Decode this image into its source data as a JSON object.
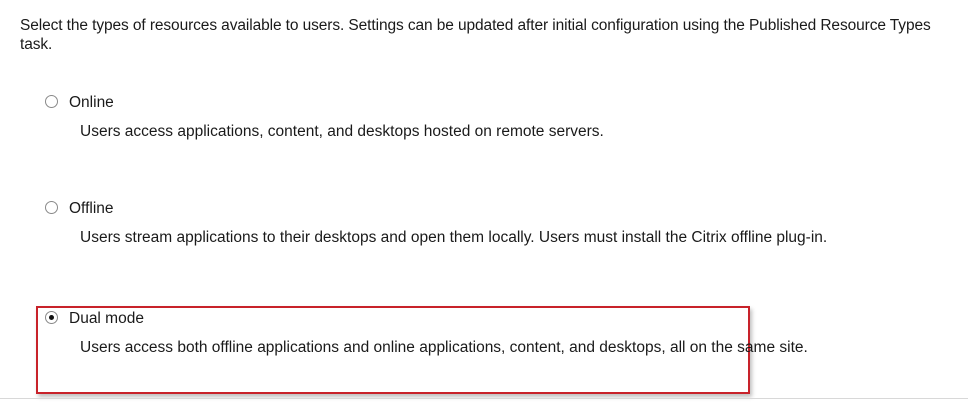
{
  "intro_text": "Select the types of resources available to users. Settings can be updated after initial configuration using the Published Resource Types task.",
  "options": [
    {
      "label": "Online",
      "description": "Users access applications, content, and desktops hosted on remote servers.",
      "selected": false
    },
    {
      "label": "Offline",
      "description": "Users stream applications to their desktops and open them locally. Users must install the Citrix offline plug-in.",
      "selected": false
    },
    {
      "label": "Dual mode",
      "description": "Users access both offline applications and online applications, content, and desktops, all on the same site.",
      "selected": true
    }
  ],
  "colors": {
    "highlight_border": "#c8222a",
    "background": "#ffffff",
    "text": "#1a1a1a"
  }
}
